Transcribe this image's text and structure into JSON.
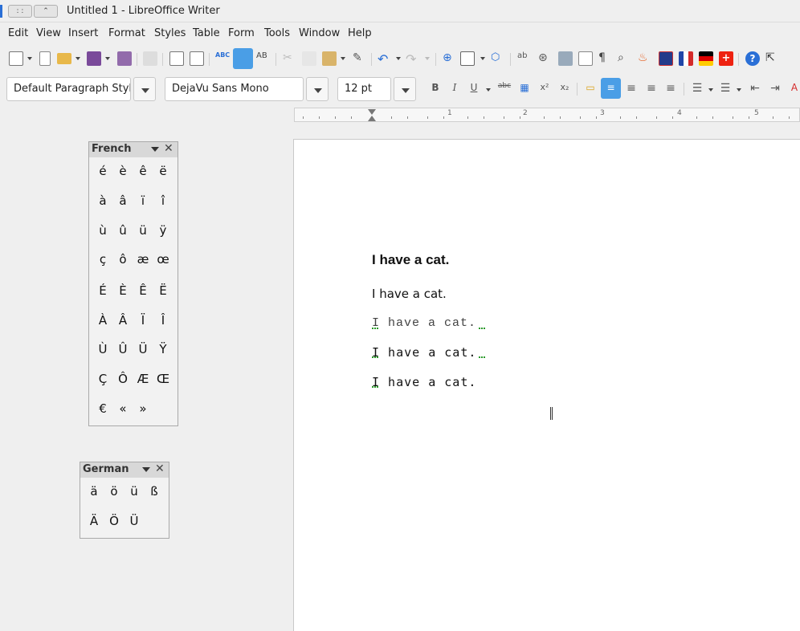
{
  "window": {
    "title": "Untitled 1 - LibreOffice Writer"
  },
  "menu": [
    "Edit",
    "View",
    "Insert",
    "Format",
    "Styles",
    "Table",
    "Form",
    "Tools",
    "Window",
    "Help"
  ],
  "format_toolbar": {
    "paragraph_style": "Default Paragraph Styl",
    "font_name": "DejaVu Sans Mono",
    "font_size": "12 pt"
  },
  "ruler": {
    "numbers": [
      "1",
      "2",
      "3",
      "4",
      "5"
    ]
  },
  "french_panel": {
    "title": "French",
    "rows": [
      [
        "é",
        "è",
        "ê",
        "ë"
      ],
      [
        "à",
        "â",
        "ï",
        "î"
      ],
      [
        "ù",
        "û",
        "ü",
        "ÿ"
      ],
      [
        "ç",
        "ô",
        "æ",
        "œ"
      ],
      [
        "É",
        "È",
        "Ê",
        "Ë"
      ],
      [
        "À",
        "Â",
        "Ï",
        "Î"
      ],
      [
        "Ù",
        "Û",
        "Ü",
        "Ÿ"
      ],
      [
        "Ç",
        "Ô",
        "Æ",
        "Œ"
      ],
      [
        "€",
        "«",
        "»"
      ]
    ]
  },
  "german_panel": {
    "title": "German",
    "rows": [
      [
        "ä",
        "ö",
        "ü",
        "ß"
      ],
      [
        "Ä",
        "Ö",
        "Ü"
      ]
    ]
  },
  "document": {
    "lines": [
      "I have a cat.",
      "I have a cat.",
      "I have a cat.",
      "I have a cat.",
      "I have a cat."
    ]
  },
  "colors": {
    "accent": "#2a6fd6",
    "spell_underline": "#2a9a2a"
  }
}
